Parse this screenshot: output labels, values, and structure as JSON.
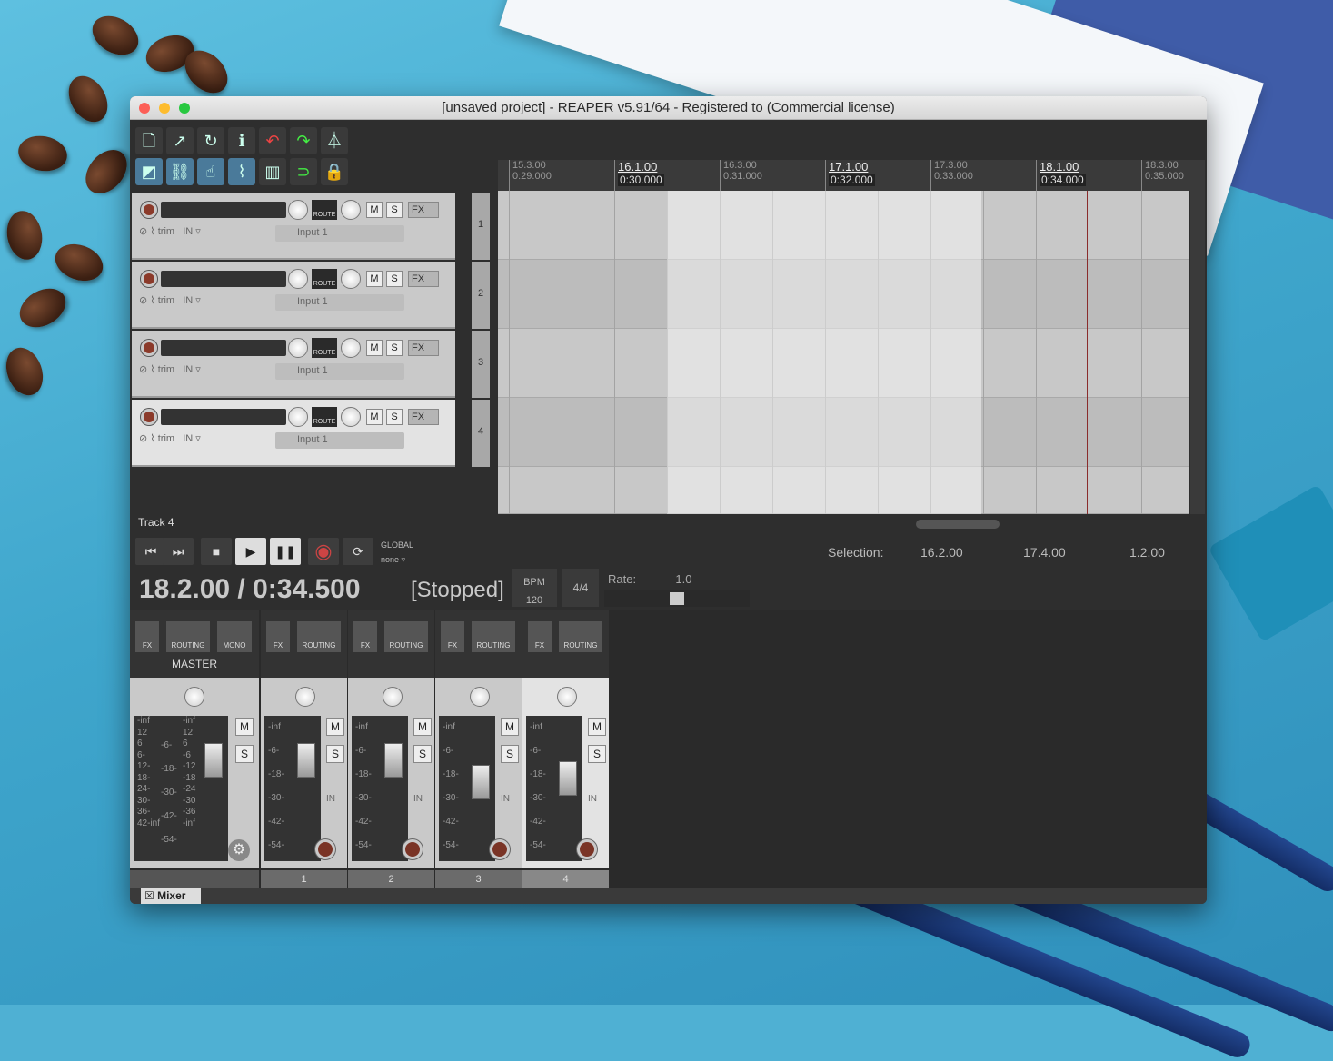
{
  "window": {
    "title": "[unsaved project] - REAPER v5.91/64 - Registered to  (Commercial license)"
  },
  "tracks": [
    {
      "number": "1",
      "trim_label": "trim",
      "in_label": "IN",
      "input": "Input 1",
      "route": "ROUTE",
      "mute": "M",
      "solo": "S",
      "fx": "FX"
    },
    {
      "number": "2",
      "trim_label": "trim",
      "in_label": "IN",
      "input": "Input 1",
      "route": "ROUTE",
      "mute": "M",
      "solo": "S",
      "fx": "FX"
    },
    {
      "number": "3",
      "trim_label": "trim",
      "in_label": "IN",
      "input": "Input 1",
      "route": "ROUTE",
      "mute": "M",
      "solo": "S",
      "fx": "FX"
    },
    {
      "number": "4",
      "trim_label": "trim",
      "in_label": "IN",
      "input": "Input 1",
      "route": "ROUTE",
      "mute": "M",
      "solo": "S",
      "fx": "FX"
    }
  ],
  "selected_track_name": "Track 4",
  "ruler": [
    {
      "bar": "15.3.00",
      "time": "0:29.000",
      "major": false
    },
    {
      "bar": "16.1.00",
      "time": "0:30.000",
      "major": true
    },
    {
      "bar": "16.3.00",
      "time": "0:31.000",
      "major": false
    },
    {
      "bar": "17.1.00",
      "time": "0:32.000",
      "major": true
    },
    {
      "bar": "17.3.00",
      "time": "0:33.000",
      "major": false
    },
    {
      "bar": "18.1.00",
      "time": "0:34.000",
      "major": true
    },
    {
      "bar": "18.3.00",
      "time": "0:35.000",
      "major": false
    }
  ],
  "transport": {
    "position": "18.2.00 / 0:34.500",
    "state": "[Stopped]",
    "bpm_label": "BPM",
    "bpm": "120",
    "time_signature": "4/4",
    "rate_label": "Rate:",
    "rate": "1.0",
    "rate_fraction": 0.5,
    "global_label": "GLOBAL",
    "global_value": "none"
  },
  "selection": {
    "label": "Selection:",
    "start": "16.2.00",
    "end": "17.4.00",
    "length": "1.2.00"
  },
  "mixer": {
    "master_label": "MASTER",
    "fx": "FX",
    "routing": "ROUTING",
    "mono": "MONO",
    "mute": "M",
    "solo": "S",
    "in_label": "IN",
    "meter_labels": [
      "-inf",
      "-6-",
      "-18-",
      "-30-",
      "-42-",
      "-54-"
    ],
    "master_meter_labels": [
      "-inf",
      "12",
      "6",
      "6-",
      "12-",
      "18-",
      "24-",
      "30-",
      "36-",
      "42-inf"
    ],
    "master_meter_labels_mid": [
      "-6-",
      "-18-",
      "-30-",
      "-42-",
      "-54-"
    ],
    "master_meter_labels_right": [
      "-inf",
      "12",
      "6",
      "-6",
      "-12",
      "-18",
      "-24",
      "-30",
      "-36",
      "-inf"
    ],
    "strip_numbers": [
      "1",
      "2",
      "3",
      "4"
    ],
    "tab_label": "Mixer"
  },
  "colors": {
    "record": "#8b3a2a",
    "cursor": "#8a2c2c",
    "accent_green": "#2fa84f"
  }
}
